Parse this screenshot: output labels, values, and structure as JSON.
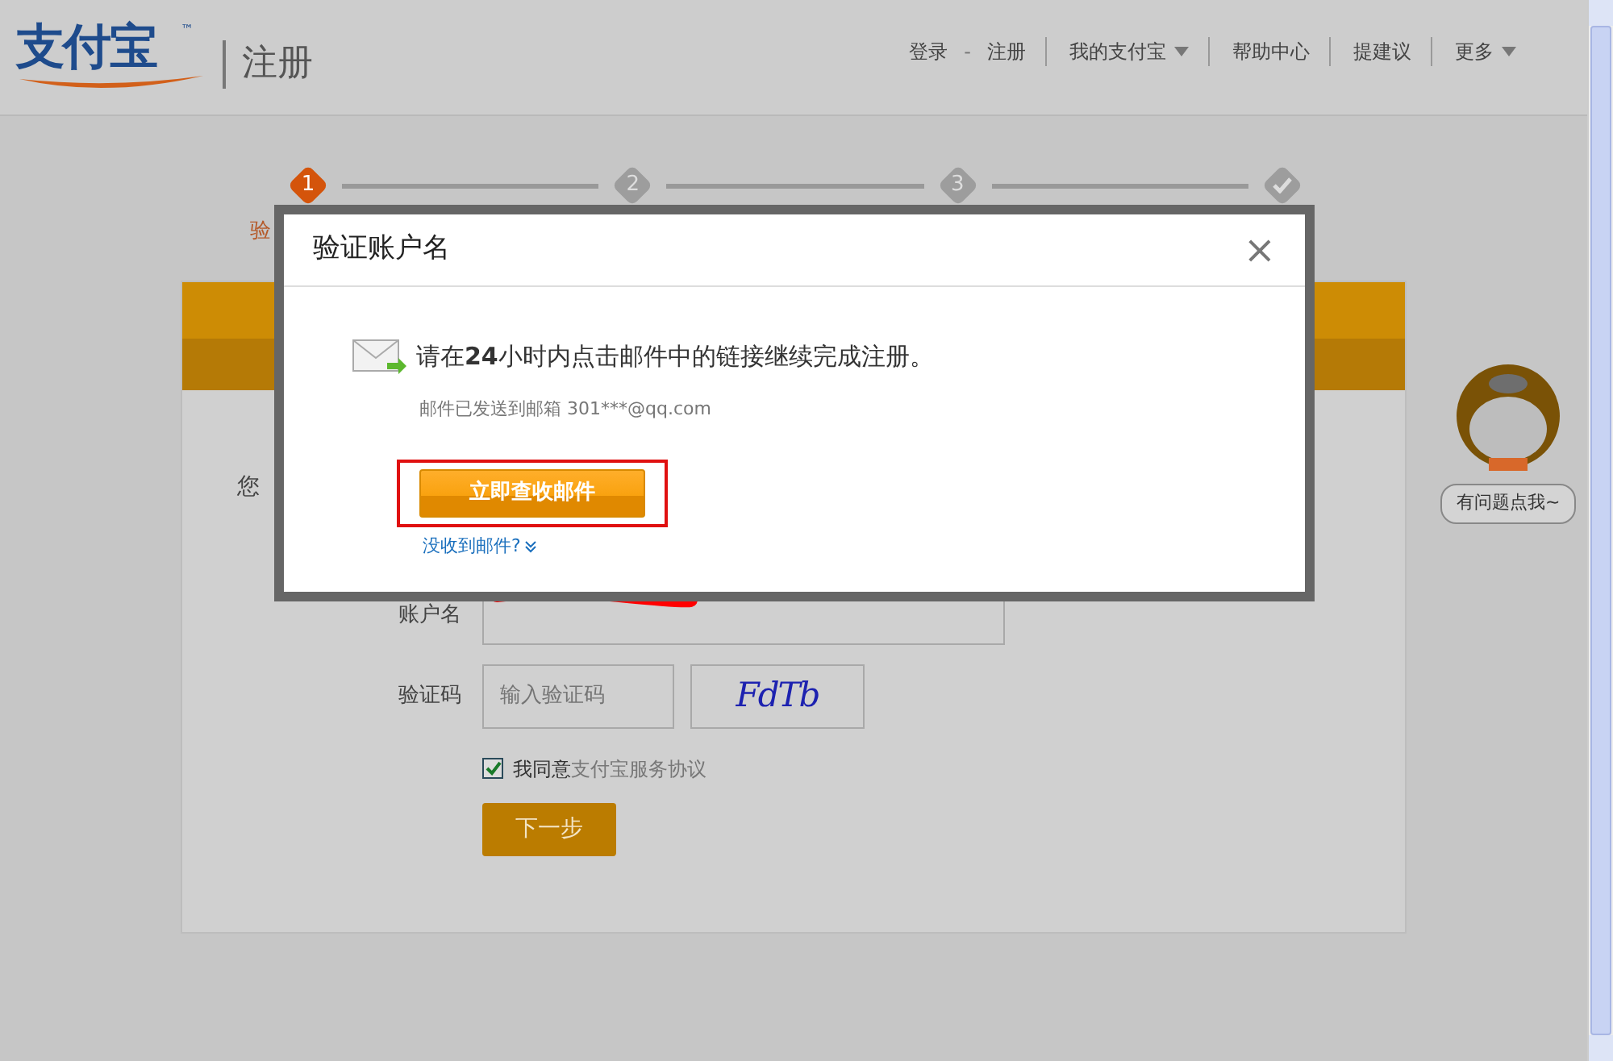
{
  "header": {
    "logo": "支付宝",
    "logo_mark": "™",
    "page_title": "注册",
    "nav": [
      {
        "label": "登录",
        "kind": "link",
        "dropdown": false,
        "divider_after": false
      },
      {
        "label": "-",
        "kind": "sep"
      },
      {
        "label": "注册",
        "kind": "link",
        "dropdown": false,
        "divider_after": true
      },
      {
        "label": "我的支付宝",
        "kind": "link",
        "dropdown": true,
        "divider_after": true
      },
      {
        "label": "帮助中心",
        "kind": "link",
        "dropdown": false,
        "divider_after": true
      },
      {
        "label": "提建议",
        "kind": "link",
        "dropdown": false,
        "divider_after": true
      },
      {
        "label": "更多",
        "kind": "link",
        "dropdown": true,
        "divider_after": false
      }
    ]
  },
  "steps": [
    {
      "kind": "number",
      "label": "1",
      "current": true
    },
    {
      "kind": "number",
      "label": "2",
      "current": false
    },
    {
      "kind": "number",
      "label": "3",
      "current": false
    },
    {
      "kind": "check",
      "current": false
    }
  ],
  "step_label": "验",
  "form": {
    "intro": "您",
    "account_label": "账户名",
    "captcha_label": "验证码",
    "captcha_placeholder": "输入验证码",
    "captcha_text": "FdTb",
    "agree": {
      "checked": true,
      "text": "我同意",
      "link": "支付宝服务协议"
    },
    "submit": "下一步"
  },
  "dialog": {
    "title": "验证账户名",
    "close": "×",
    "message": "请在**24**小时内点击邮件中的链接继续完成注册。",
    "sent_note": "邮件已发送到邮箱 301***@qq.com",
    "action": "立即查收邮件",
    "action_highlighted": true,
    "help_link": "没收到邮件?"
  },
  "helper": {
    "bubble": "有问题点我~"
  }
}
